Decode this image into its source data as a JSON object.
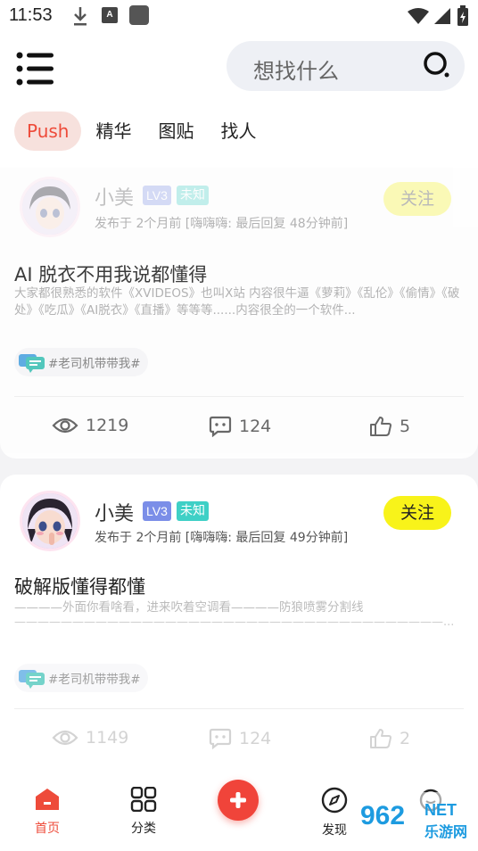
{
  "status_bar": {
    "time": "11:53",
    "a_icon": "A"
  },
  "header": {
    "search_placeholder": "想找什么"
  },
  "tabs": [
    {
      "label": "Push",
      "active": true
    },
    {
      "label": "精华",
      "active": false
    },
    {
      "label": "图贴",
      "active": false
    },
    {
      "label": "找人",
      "active": false
    }
  ],
  "posts": [
    {
      "username": "小美",
      "level": "LV3",
      "gender": "未知",
      "meta": "发布于 2个月前 [嗨嗨嗨: 最后回复 48分钟前]",
      "follow_label": "关注",
      "title": "AI 脱衣不用我说都懂得",
      "excerpt": "大家都很熟悉的软件《XVIDEOS》也叫X站 内容很牛逼《萝莉》《乱伦》《偷情》《破处》《吃瓜》《AI脱衣》《直播》等等等......内容很全的一个软件...",
      "tag": "#老司机带带我#",
      "views": "1219",
      "comments": "124",
      "likes": "5"
    },
    {
      "username": "小美",
      "level": "LV3",
      "gender": "未知",
      "meta": "发布于 2个月前 [嗨嗨嗨: 最后回复 49分钟前]",
      "follow_label": "关注",
      "title": "破解版懂得都懂",
      "excerpt": "————外面你看啥看，进来吹着空调看————防狼喷雾分割线",
      "excerpt2": "—————————————————————————————————————...",
      "tag": "#老司机带带我#",
      "views": "1149",
      "comments": "124",
      "likes": "2"
    }
  ],
  "bottom_nav": {
    "home": "首页",
    "category": "分类",
    "discover": "发现",
    "messages": "消息"
  },
  "watermark": {
    "brand": "962",
    "net": "NET",
    "sub": "乐游网"
  },
  "colors": {
    "accent": "#ee4b3a",
    "follow_yellow": "#f8f31a",
    "level_badge": "#7b8ee8",
    "gender_badge": "#3fd0c6"
  }
}
